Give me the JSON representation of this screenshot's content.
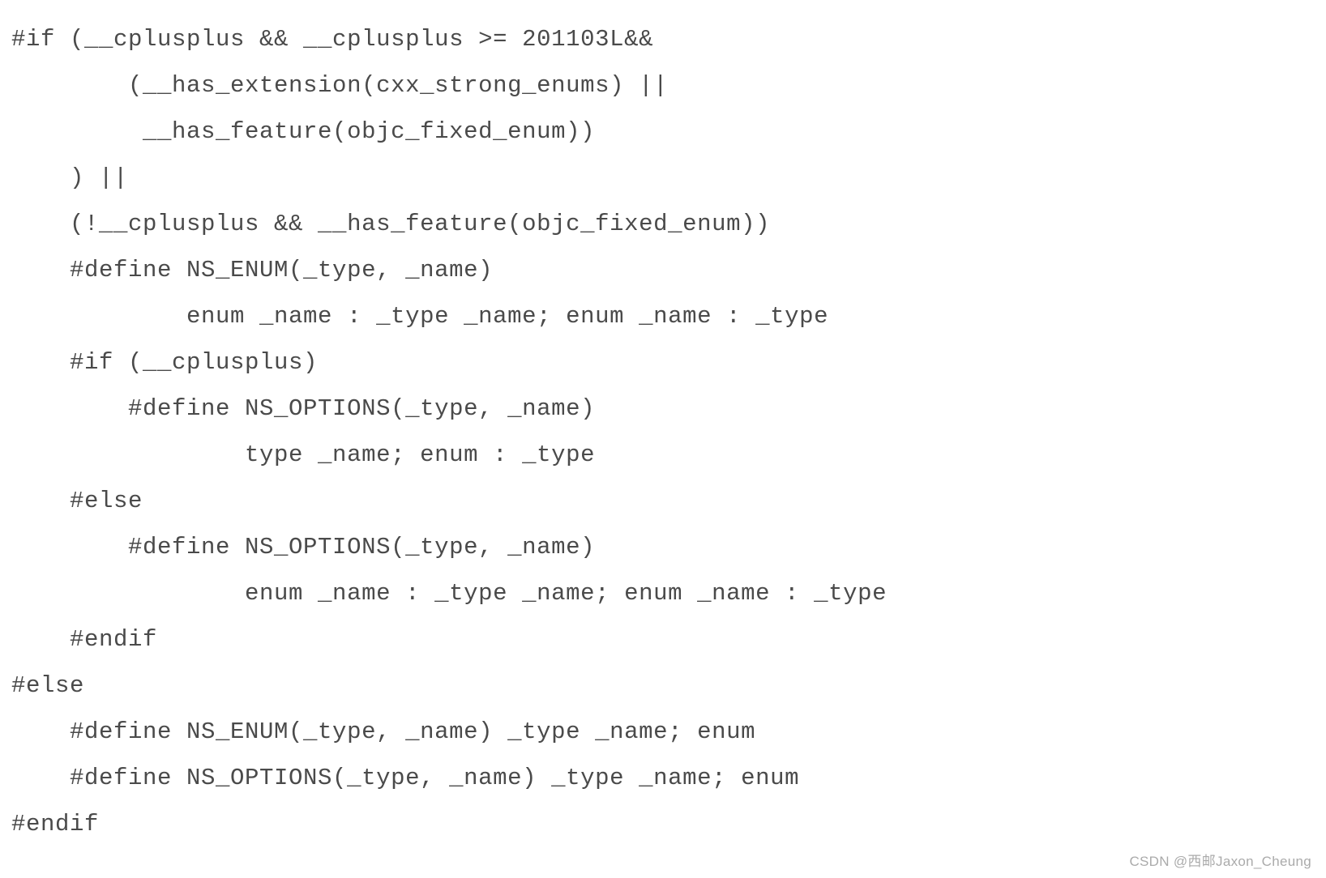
{
  "code": {
    "lines": [
      "#if (__cplusplus && __cplusplus >= 201103L&&",
      "        (__has_extension(cxx_strong_enums) ||",
      "         __has_feature(objc_fixed_enum))",
      "    ) ||",
      "    (!__cplusplus && __has_feature(objc_fixed_enum))",
      "    #define NS_ENUM(_type, _name)",
      "            enum _name : _type _name; enum _name : _type",
      "    #if (__cplusplus)",
      "        #define NS_OPTIONS(_type, _name)",
      "                type _name; enum : _type",
      "    #else",
      "        #define NS_OPTIONS(_type, _name)",
      "                enum _name : _type _name; enum _name : _type",
      "    #endif",
      "#else",
      "    #define NS_ENUM(_type, _name) _type _name; enum",
      "    #define NS_OPTIONS(_type, _name) _type _name; enum",
      "#endif"
    ]
  },
  "watermark": "CSDN @西邮Jaxon_Cheung"
}
